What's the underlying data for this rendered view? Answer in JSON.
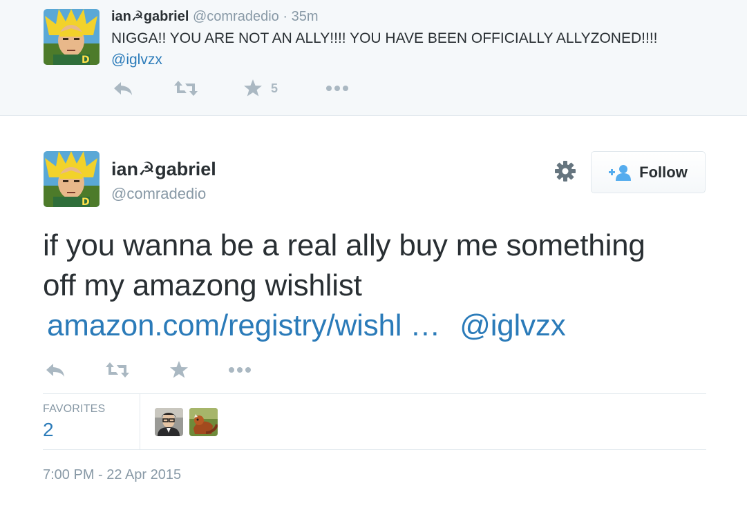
{
  "parent_tweet": {
    "name": "ian☭gabriel",
    "handle": "@comradedio",
    "separator": "·",
    "time": "35m",
    "text": "NIGGA!! YOU ARE NOT AN ALLY!!!! YOU HAVE BEEN OFFICIALLY ALLYZONED!!!!",
    "mention": "@iglvzx",
    "favorite_count": "5",
    "avatar_icon": "anime-character-avatar"
  },
  "main_tweet": {
    "name": "ian☭gabriel",
    "handle": "@comradedio",
    "follow_label": "Follow",
    "text": "if you wanna be a real ally buy me something off my amazong wishlist",
    "link_text": "amazon.com/registry/wishl  …",
    "mention": "@iglvzx",
    "favorites_label": "FAVORITES",
    "favorites_count": "2",
    "timestamp": "7:00 PM - 22 Apr 2015",
    "avatar_icon": "anime-character-avatar",
    "favoriter_avatars": [
      "person-with-glasses-avatar",
      "red-panda-avatar"
    ]
  },
  "colors": {
    "link": "#2b7bb9",
    "muted": "#8899a6",
    "icon": "#aab8c2",
    "text": "#292f33",
    "parent_background": "#f5f8fa"
  }
}
